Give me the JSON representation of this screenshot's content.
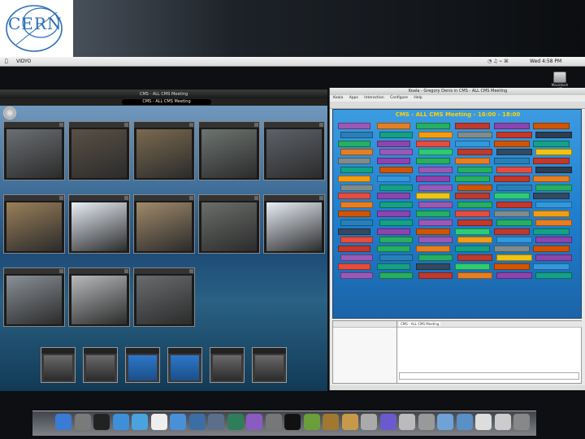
{
  "banner": {
    "logo_text": "CERN"
  },
  "menubar": {
    "apple": "",
    "app": "VIDYO",
    "status": "",
    "clock": "Wed 4:58 PM"
  },
  "desktop": {
    "hd_label": "Macintosh HD"
  },
  "evo": {
    "window_title": "CMS - ALL CMS Meeting",
    "self_user": "",
    "meeting_name": "CMS - ALL CMS Meeting",
    "count": "",
    "tiles": [
      {
        "label": "",
        "color": "#6b6f73"
      },
      {
        "label": "",
        "color": "#5a5045"
      },
      {
        "label": "",
        "color": "#7a6a50"
      },
      {
        "label": "",
        "color": "#6d7470"
      },
      {
        "label": "",
        "color": "#5d6269"
      },
      {
        "label": "",
        "color": "#9a7f5a"
      },
      {
        "label": "",
        "color": "#e8eef6"
      },
      {
        "label": "",
        "color": "#a08a6a"
      },
      {
        "label": "",
        "color": "#6a6e6a"
      },
      {
        "label": "",
        "color": "#e8eef6"
      },
      {
        "label": "",
        "color": "#8a9097"
      },
      {
        "label": "",
        "color": "#b7b9bb"
      },
      {
        "label": "",
        "color": "#696c6e"
      }
    ],
    "thumbs": [
      {
        "label": "",
        "kind": "video"
      },
      {
        "label": "",
        "kind": "video"
      },
      {
        "label": "",
        "kind": "evo"
      },
      {
        "label": "",
        "kind": "evo"
      },
      {
        "label": "",
        "kind": "video"
      },
      {
        "label": "",
        "kind": "video"
      }
    ]
  },
  "koala": {
    "window_title": "Koala - Gregory Denis in CMS - ALL CMS Meeting",
    "menu": [
      "Koala",
      "Apps",
      "Interaction",
      "Configure",
      "Help"
    ],
    "tools": "",
    "wall_title": "CMS - ALL CMS Meeting - 16:00 - 18:00",
    "contacts_header": "",
    "contacts_group": "",
    "contacts": [
      "",
      "",
      "",
      "",
      "",
      ""
    ],
    "chat_tabs": [
      "",
      "",
      "",
      "",
      "CMS - ALL CMS Meeting"
    ],
    "chat_messages": [
      {
        "time": "",
        "user": "",
        "text": ""
      },
      {
        "time": "",
        "user": "",
        "text": ""
      },
      {
        "time": "",
        "user": "",
        "text": ""
      },
      {
        "time": "",
        "user": "",
        "text": ""
      },
      {
        "time": "",
        "user": "",
        "text": ""
      },
      {
        "time": "",
        "user": "",
        "text": ""
      }
    ],
    "status": ""
  },
  "participants": [
    {
      "name": "",
      "color": "#9b59b6"
    },
    {
      "name": "",
      "color": "#e67e22"
    },
    {
      "name": "",
      "color": "#27ae60"
    },
    {
      "name": "",
      "color": "#c0392b"
    },
    {
      "name": "",
      "color": "#8e44ad"
    },
    {
      "name": "",
      "color": "#d35400"
    },
    {
      "name": "",
      "color": "#2980b9"
    },
    {
      "name": "",
      "color": "#16a085"
    },
    {
      "name": "",
      "color": "#f39c12"
    },
    {
      "name": "",
      "color": "#7f8c8d"
    },
    {
      "name": "",
      "color": "#c0392b"
    },
    {
      "name": "",
      "color": "#2c3e50"
    },
    {
      "name": "",
      "color": "#27ae60"
    },
    {
      "name": "",
      "color": "#8e44ad"
    },
    {
      "name": "",
      "color": "#e74c3c"
    },
    {
      "name": "",
      "color": "#3498db"
    },
    {
      "name": "",
      "color": "#d35400"
    },
    {
      "name": "",
      "color": "#16a085"
    },
    {
      "name": "",
      "color": "#e67e22"
    },
    {
      "name": "",
      "color": "#9b59b6"
    },
    {
      "name": "",
      "color": "#2ecc71"
    },
    {
      "name": "",
      "color": "#c0392b"
    },
    {
      "name": "",
      "color": "#34495e"
    },
    {
      "name": "",
      "color": "#f1c40f"
    },
    {
      "name": "",
      "color": "#7f8c8d"
    },
    {
      "name": "",
      "color": "#8e44ad"
    },
    {
      "name": "",
      "color": "#27ae60"
    },
    {
      "name": "",
      "color": "#e67e22"
    },
    {
      "name": "",
      "color": "#2980b9"
    },
    {
      "name": "",
      "color": "#c0392b"
    },
    {
      "name": "",
      "color": "#16a085"
    },
    {
      "name": "",
      "color": "#d35400"
    },
    {
      "name": "",
      "color": "#9b59b6"
    },
    {
      "name": "",
      "color": "#27ae60"
    },
    {
      "name": "",
      "color": "#e74c3c"
    },
    {
      "name": "",
      "color": "#2c3e50"
    },
    {
      "name": "",
      "color": "#f39c12"
    },
    {
      "name": "",
      "color": "#3498db"
    },
    {
      "name": "",
      "color": "#8e44ad"
    },
    {
      "name": "",
      "color": "#27ae60"
    },
    {
      "name": "",
      "color": "#c0392b"
    },
    {
      "name": "",
      "color": "#e67e22"
    },
    {
      "name": "",
      "color": "#7f8c8d"
    },
    {
      "name": "",
      "color": "#16a085"
    },
    {
      "name": "",
      "color": "#9b59b6"
    },
    {
      "name": "",
      "color": "#d35400"
    },
    {
      "name": "",
      "color": "#2980b9"
    },
    {
      "name": "",
      "color": "#27ae60"
    },
    {
      "name": "",
      "color": "#e74c3c"
    },
    {
      "name": "",
      "color": "#8e44ad"
    },
    {
      "name": "",
      "color": "#f1c40f"
    },
    {
      "name": "",
      "color": "#c0392b"
    },
    {
      "name": "",
      "color": "#2ecc71"
    },
    {
      "name": "",
      "color": "#34495e"
    },
    {
      "name": "",
      "color": "#e67e22"
    },
    {
      "name": "",
      "color": "#16a085"
    },
    {
      "name": "",
      "color": "#9b59b6"
    },
    {
      "name": "",
      "color": "#27ae60"
    },
    {
      "name": "",
      "color": "#c0392b"
    },
    {
      "name": "",
      "color": "#3498db"
    },
    {
      "name": "",
      "color": "#d35400"
    },
    {
      "name": "",
      "color": "#8e44ad"
    },
    {
      "name": "",
      "color": "#27ae60"
    },
    {
      "name": "",
      "color": "#e74c3c"
    },
    {
      "name": "",
      "color": "#7f8c8d"
    },
    {
      "name": "",
      "color": "#f39c12"
    },
    {
      "name": "",
      "color": "#2980b9"
    },
    {
      "name": "",
      "color": "#16a085"
    },
    {
      "name": "",
      "color": "#9b59b6"
    },
    {
      "name": "",
      "color": "#c0392b"
    },
    {
      "name": "",
      "color": "#27ae60"
    },
    {
      "name": "",
      "color": "#e67e22"
    },
    {
      "name": "",
      "color": "#34495e"
    },
    {
      "name": "",
      "color": "#8e44ad"
    },
    {
      "name": "",
      "color": "#d35400"
    },
    {
      "name": "",
      "color": "#2ecc71"
    },
    {
      "name": "",
      "color": "#c0392b"
    },
    {
      "name": "",
      "color": "#16a085"
    },
    {
      "name": "",
      "color": "#e74c3c"
    },
    {
      "name": "",
      "color": "#27ae60"
    },
    {
      "name": "",
      "color": "#9b59b6"
    },
    {
      "name": "",
      "color": "#f39c12"
    },
    {
      "name": "",
      "color": "#3498db"
    },
    {
      "name": "",
      "color": "#8e44ad"
    },
    {
      "name": "",
      "color": "#c0392b"
    },
    {
      "name": "",
      "color": "#27ae60"
    },
    {
      "name": "",
      "color": "#e67e22"
    },
    {
      "name": "",
      "color": "#16a085"
    },
    {
      "name": "",
      "color": "#7f8c8d"
    },
    {
      "name": "",
      "color": "#d35400"
    },
    {
      "name": "",
      "color": "#9b59b6"
    },
    {
      "name": "",
      "color": "#2980b9"
    },
    {
      "name": "",
      "color": "#27ae60"
    },
    {
      "name": "",
      "color": "#c0392b"
    },
    {
      "name": "",
      "color": "#f1c40f"
    },
    {
      "name": "",
      "color": "#8e44ad"
    },
    {
      "name": "",
      "color": "#e74c3c"
    },
    {
      "name": "",
      "color": "#16a085"
    },
    {
      "name": "",
      "color": "#34495e"
    },
    {
      "name": "",
      "color": "#2ecc71"
    },
    {
      "name": "",
      "color": "#d35400"
    },
    {
      "name": "",
      "color": "#3498db"
    },
    {
      "name": "",
      "color": "#9b59b6"
    },
    {
      "name": "",
      "color": "#27ae60"
    },
    {
      "name": "",
      "color": "#c0392b"
    },
    {
      "name": "",
      "color": "#e67e22"
    },
    {
      "name": "",
      "color": "#8e44ad"
    },
    {
      "name": "",
      "color": "#16a085"
    }
  ],
  "dock": {
    "icons": [
      {
        "name": "finder-icon",
        "color": "#3a7bd5"
      },
      {
        "name": "photo-icon",
        "color": "#7a7a7a"
      },
      {
        "name": "dashboard-icon",
        "color": "#222222"
      },
      {
        "name": "safari-icon",
        "color": "#3c8fd8"
      },
      {
        "name": "ichat-icon",
        "color": "#4aa3df"
      },
      {
        "name": "calendar-icon",
        "color": "#eeeeee"
      },
      {
        "name": "itunes-icon",
        "color": "#4a90d9"
      },
      {
        "name": "iphoto-icon",
        "color": "#3a6ea5"
      },
      {
        "name": "window-icon",
        "color": "#5b6f8a"
      },
      {
        "name": "timemachine-icon",
        "color": "#2f7d5a"
      },
      {
        "name": "network-icon",
        "color": "#8a5cc2"
      },
      {
        "name": "preferences-icon",
        "color": "#777777"
      },
      {
        "name": "terminal-icon",
        "color": "#111111"
      },
      {
        "name": "hands-icon",
        "color": "#6a9e3a"
      },
      {
        "name": "plant-icon",
        "color": "#a0782f"
      },
      {
        "name": "cat-icon",
        "color": "#c79a4a"
      },
      {
        "name": "bin-icon",
        "color": "#aaaaaa"
      },
      {
        "name": "u-icon",
        "color": "#6a5acd"
      },
      {
        "name": "stack-icon",
        "color": "#bbbbbb"
      },
      {
        "name": "utility-icon",
        "color": "#999999"
      },
      {
        "name": "folder-icon",
        "color": "#6fa3d8"
      },
      {
        "name": "downloads-icon",
        "color": "#5a8fc8"
      },
      {
        "name": "docs-icon",
        "color": "#dddddd"
      },
      {
        "name": "bar-icon",
        "color": "#cccccc"
      },
      {
        "name": "trash-icon",
        "color": "#888888"
      }
    ]
  }
}
